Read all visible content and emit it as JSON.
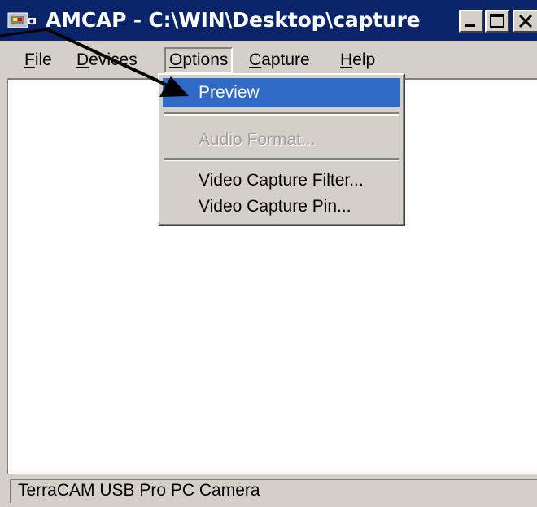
{
  "window": {
    "title": "AMCAP - C:\\WIN\\Desktop\\capture",
    "icon": "amcap-app-icon",
    "controls": [
      "minimize-icon",
      "maximize-icon",
      "close-icon"
    ]
  },
  "menubar": {
    "items": [
      {
        "label": "File"
      },
      {
        "label": "Devices"
      },
      {
        "label": "Options"
      },
      {
        "label": "Capture"
      },
      {
        "label": "Help"
      }
    ]
  },
  "options_menu": {
    "items": [
      {
        "label": "Preview",
        "state": "highlighted"
      },
      {
        "label": "Audio Format...",
        "state": "disabled"
      },
      {
        "label": "Video Capture Filter...",
        "state": "enabled"
      },
      {
        "label": "Video Capture Pin...",
        "state": "enabled"
      }
    ]
  },
  "statusbar": {
    "text": "TerraCAM USB Pro PC Camera"
  },
  "colors": {
    "title_bar": "#0a246a",
    "highlight": "#316ac5",
    "face": "#d4d0c8"
  }
}
